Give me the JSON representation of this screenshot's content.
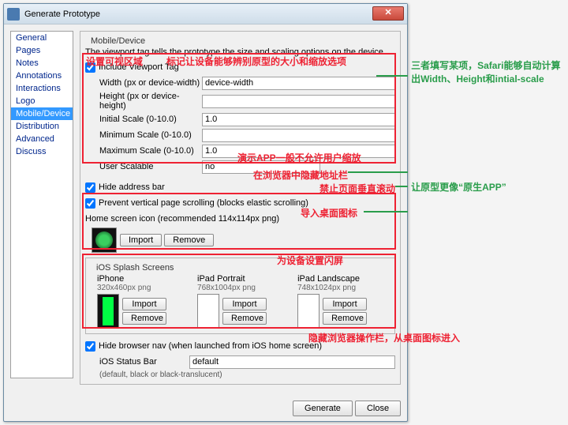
{
  "window": {
    "title": "Generate Prototype"
  },
  "sidebar": {
    "items": [
      "General",
      "Pages",
      "Notes",
      "Annotations",
      "Interactions",
      "Logo",
      "Mobile/Device",
      "Distribution",
      "Advanced",
      "Discuss"
    ],
    "selected": 6
  },
  "mobile": {
    "legend": "Mobile/Device",
    "desc": "The viewport tag tells the prototype the size and scaling options on the device.",
    "includeViewport": "Include Viewport Tag",
    "widthLbl": "Width (px or device-width)",
    "widthVal": "device-width",
    "heightLbl": "Height (px or device-height)",
    "heightVal": "",
    "initScaleLbl": "Initial Scale (0-10.0)",
    "initScaleVal": "1.0",
    "minScaleLbl": "Minimum Scale (0-10.0)",
    "minScaleVal": "",
    "maxScaleLbl": "Maximum Scale (0-10.0)",
    "maxScaleVal": "1.0",
    "userScaleLbl": "User Scalable",
    "userScaleVal": "no",
    "hideAddr": "Hide address bar",
    "preventScroll": "Prevent vertical page scrolling (blocks elastic scrolling)",
    "homeIcon": "Home screen icon (recommended 114x114px png)",
    "import": "Import",
    "remove": "Remove",
    "splashLegend": "iOS Splash Screens",
    "iphone": {
      "t": "iPhone",
      "s": "320x460px png"
    },
    "ipadP": {
      "t": "iPad Portrait",
      "s": "768x1004px png"
    },
    "ipadL": {
      "t": "iPad Landscape",
      "s": "748x1024px png"
    },
    "hideBrowserNav": "Hide browser nav (when launched from iOS home screen)",
    "statusLbl": "iOS Status Bar",
    "statusVal": "default",
    "statusHelp": "(default, black or black-translucent)"
  },
  "footer": {
    "generate": "Generate",
    "close": "Close"
  },
  "annot": {
    "a1": "设置可视区域",
    "a2": "标记让设备能够辨别原型的大小和缩放选项",
    "a3": "演示APP一般不允许用户缩放",
    "a4": "在浏览器中隐藏地址栏",
    "a5": "禁止页面垂直滚动",
    "a6": "导入桌面图标",
    "a7": "为设备设置闪屏",
    "a8": "隐藏浏览器操作栏，从桌面图标进入",
    "r1": "三者填写某项，Safari能够自动计算出Width、Height和intial-scale",
    "r2": "让原型更像“原生APP”"
  }
}
